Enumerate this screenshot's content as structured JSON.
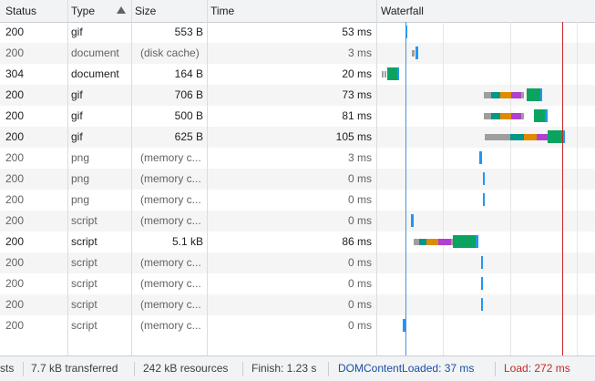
{
  "columns": {
    "status": "Status",
    "type": "Type",
    "size": "Size",
    "time": "Time",
    "waterfall": "Waterfall"
  },
  "colors": {
    "queue": "#9e9e9e",
    "dns": "#009688",
    "connect": "#e08a00",
    "ssl": "#b040d0",
    "waiting": "#0ba360",
    "download": "#2196f3",
    "dom_line": "#4a90d9",
    "load_line": "#c62828"
  },
  "rows": [
    {
      "status": "200",
      "type": "gif",
      "size": "553 B",
      "time": "53 ms",
      "dim": false,
      "cached": false
    },
    {
      "status": "200",
      "type": "document",
      "size": "(disk cache)",
      "time": "3 ms",
      "dim": true,
      "cached": true
    },
    {
      "status": "304",
      "type": "document",
      "size": "164 B",
      "time": "20 ms",
      "dim": false,
      "cached": false
    },
    {
      "status": "200",
      "type": "gif",
      "size": "706 B",
      "time": "73 ms",
      "dim": false,
      "cached": false
    },
    {
      "status": "200",
      "type": "gif",
      "size": "500 B",
      "time": "81 ms",
      "dim": false,
      "cached": false
    },
    {
      "status": "200",
      "type": "gif",
      "size": "625 B",
      "time": "105 ms",
      "dim": false,
      "cached": false
    },
    {
      "status": "200",
      "type": "png",
      "size": "(memory c...",
      "time": "3 ms",
      "dim": true,
      "cached": true
    },
    {
      "status": "200",
      "type": "png",
      "size": "(memory c...",
      "time": "0 ms",
      "dim": true,
      "cached": true
    },
    {
      "status": "200",
      "type": "png",
      "size": "(memory c...",
      "time": "0 ms",
      "dim": true,
      "cached": true
    },
    {
      "status": "200",
      "type": "script",
      "size": "(memory c...",
      "time": "0 ms",
      "dim": true,
      "cached": true
    },
    {
      "status": "200",
      "type": "script",
      "size": "5.1 kB",
      "time": "86 ms",
      "dim": false,
      "cached": false
    },
    {
      "status": "200",
      "type": "script",
      "size": "(memory c...",
      "time": "0 ms",
      "dim": true,
      "cached": true
    },
    {
      "status": "200",
      "type": "script",
      "size": "(memory c...",
      "time": "0 ms",
      "dim": true,
      "cached": true
    },
    {
      "status": "200",
      "type": "script",
      "size": "(memory c...",
      "time": "0 ms",
      "dim": true,
      "cached": true
    },
    {
      "status": "200",
      "type": "script",
      "size": "(memory c...",
      "time": "0 ms",
      "dim": true,
      "cached": true
    }
  ],
  "status_bar": {
    "requests_fragment": "sts",
    "transferred": "7.7 kB transferred",
    "resources": "242 kB resources",
    "finish": "Finish: 1.23 s",
    "dom_content_loaded": "DOMContentLoaded: 37 ms",
    "load": "Load: 272 ms"
  }
}
